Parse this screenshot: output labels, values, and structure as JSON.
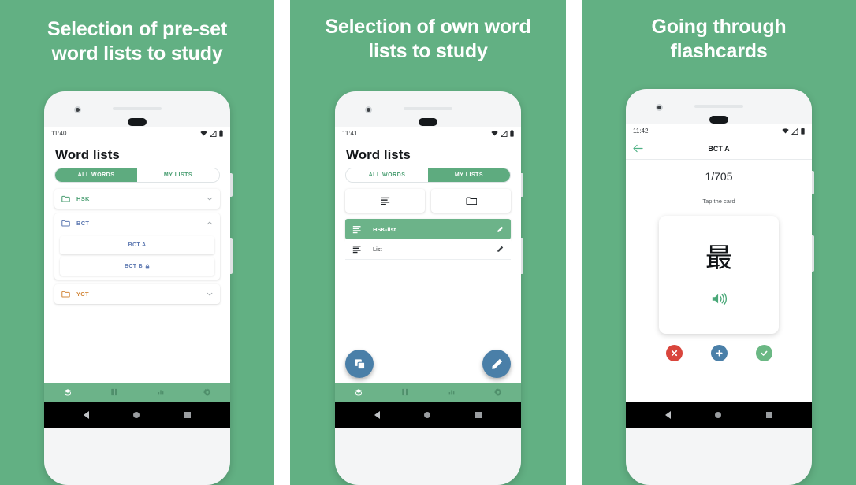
{
  "theme": {
    "background_green": "#62b083",
    "accent_green": "#6cb389",
    "tab_active_green": "#5eab7f",
    "fab_blue": "#4a7fa8",
    "reject_red": "#d9453c",
    "accept_green": "#6bb884",
    "folder_hsk_color": "#4a9e72",
    "folder_bct_color": "#5b77b0",
    "folder_yct_color": "#d2883c"
  },
  "panels": [
    {
      "headline": "Selection of pre-set\nword lists to study",
      "headline_line1": "Selection of pre-set",
      "headline_line2": "word lists to study",
      "status": {
        "time": "11:40"
      },
      "app": {
        "title": "Word lists",
        "tabs": [
          {
            "label": "ALL WORDS",
            "active": true
          },
          {
            "label": "MY LISTS",
            "active": false
          }
        ],
        "folders": [
          {
            "label": "HSK",
            "expanded": false,
            "color": "#4a9e72"
          },
          {
            "label": "BCT",
            "expanded": true,
            "color": "#5b77b0",
            "children": [
              {
                "label": "BCT A",
                "locked": false
              },
              {
                "label": "BCT B",
                "locked": true
              }
            ]
          },
          {
            "label": "YCT",
            "expanded": false,
            "color": "#d2883c"
          }
        ],
        "bottom_nav": [
          {
            "icon": "graduation-cap-icon",
            "active": true
          },
          {
            "icon": "book-icon",
            "active": false
          },
          {
            "icon": "bar-chart-icon",
            "active": false
          },
          {
            "icon": "gear-icon",
            "active": false
          }
        ]
      }
    },
    {
      "headline_line1": "Selection of own word",
      "headline_line2": "lists to study",
      "status": {
        "time": "11:41"
      },
      "app": {
        "title": "Word lists",
        "tabs": [
          {
            "label": "ALL WORDS",
            "active": false
          },
          {
            "label": "MY LISTS",
            "active": true
          }
        ],
        "create_buttons": [
          {
            "icon": "list-lines-icon"
          },
          {
            "icon": "folder-icon"
          }
        ],
        "lists": [
          {
            "label": "HSK-list",
            "selected": true,
            "action_icon": "pencil-icon"
          },
          {
            "label": "List",
            "selected": false,
            "action_icon": "pencil-icon"
          }
        ],
        "fabs": [
          {
            "icon": "copy-icon",
            "position": "left"
          },
          {
            "icon": "pencil-icon",
            "position": "right"
          }
        ],
        "bottom_nav": [
          {
            "icon": "graduation-cap-icon",
            "active": true
          },
          {
            "icon": "book-icon",
            "active": false
          },
          {
            "icon": "bar-chart-icon",
            "active": false
          },
          {
            "icon": "gear-icon",
            "active": false
          }
        ]
      }
    },
    {
      "headline_line1": "Going through",
      "headline_line2": "flashcards",
      "status": {
        "time": "11:42"
      },
      "app": {
        "back_icon": "back-arrow-icon",
        "title": "BCT A",
        "counter": "1/705",
        "hint": "Tap the card",
        "card": {
          "character": "最",
          "audio_icon": "speaker-icon"
        },
        "answer_buttons": [
          {
            "icon": "close-icon",
            "color": "#d9453c",
            "name": "reject"
          },
          {
            "icon": "plus-icon",
            "color": "#4a7fa8",
            "name": "add"
          },
          {
            "icon": "check-icon",
            "color": "#6bb884",
            "name": "accept"
          }
        ]
      }
    }
  ],
  "android_nav": {
    "back": "back-triangle-icon",
    "home": "home-circle-icon",
    "recents": "recents-square-icon"
  }
}
